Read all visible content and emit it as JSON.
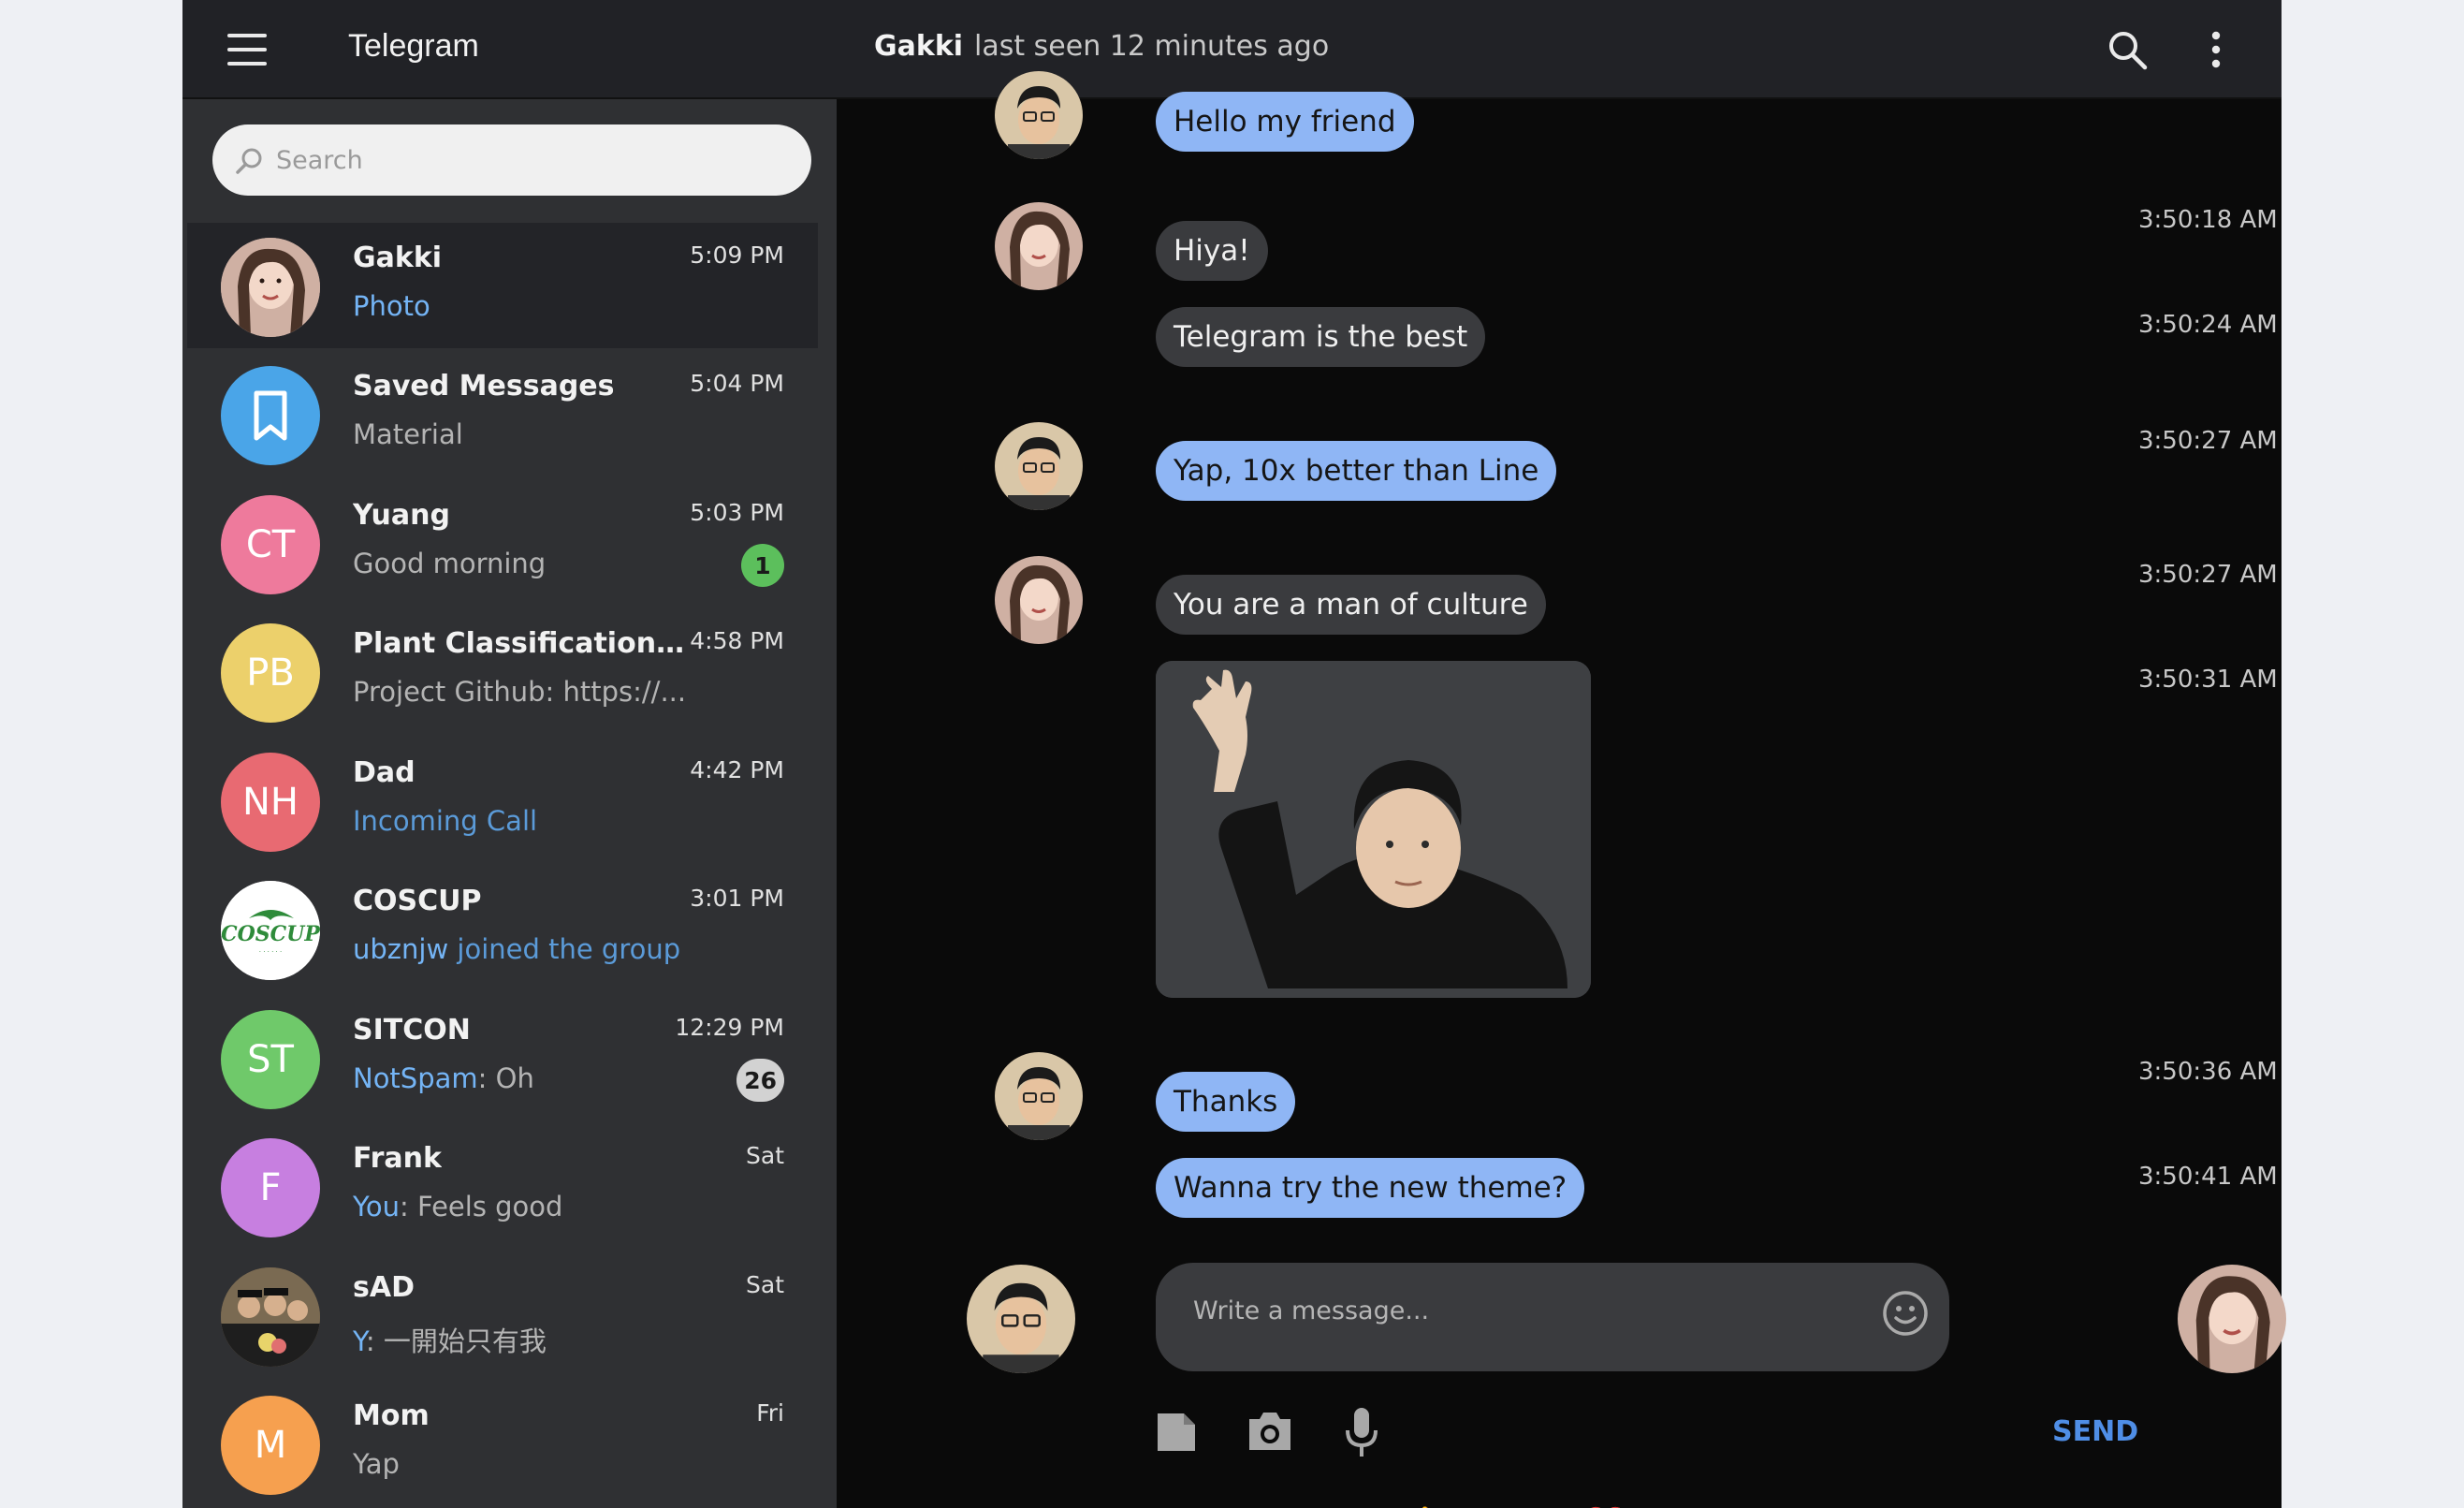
{
  "app": {
    "title": "Telegram"
  },
  "header": {
    "chat_name": "Gakki",
    "status": "last seen 12 minutes ago"
  },
  "search": {
    "placeholder": "Search"
  },
  "chats": [
    {
      "name": "Gakki",
      "time": "5:09 PM",
      "preview_sender": "",
      "preview": "Photo",
      "preview_style": "lblue",
      "avatar_text": "",
      "avatar_color": "#d9b9ad",
      "badge": ""
    },
    {
      "name": "Saved Messages",
      "time": "5:04 PM",
      "preview_sender": "",
      "preview": "Material",
      "preview_style": "grey",
      "avatar_text": "",
      "avatar_color": "#4aa5e8",
      "badge": ""
    },
    {
      "name": "Yuang",
      "time": "5:03 PM",
      "preview_sender": "",
      "preview": "Good morning",
      "preview_style": "grey",
      "avatar_text": "CT",
      "avatar_color": "#ee7a9c",
      "badge": "1"
    },
    {
      "name": "Plant Classification ...",
      "time": "4:58 PM",
      "preview_sender": "",
      "preview": "Project Github: https://...",
      "preview_style": "grey",
      "avatar_text": "PB",
      "avatar_color": "#ecd06b",
      "badge": ""
    },
    {
      "name": "Dad",
      "time": "4:42 PM",
      "preview_sender": "",
      "preview": "Incoming Call",
      "preview_style": "blue",
      "avatar_text": "NH",
      "avatar_color": "#e86a72",
      "badge": ""
    },
    {
      "name": "COSCUP",
      "time": "3:01 PM",
      "preview_sender": "ubznjw",
      "preview": " joined the group",
      "preview_style": "blue",
      "avatar_text": "COSCUP",
      "avatar_color": "#ffffff",
      "badge": ""
    },
    {
      "name": "SITCON",
      "time": "12:29 PM",
      "preview_sender": "NotSpam",
      "preview": ": Oh",
      "preview_style": "grey",
      "avatar_text": "ST",
      "avatar_color": "#6fc96a",
      "badge": "26"
    },
    {
      "name": "Frank",
      "time": "Sat",
      "preview_sender": "You",
      "preview": ": Feels good",
      "preview_style": "grey",
      "avatar_text": "F",
      "avatar_color": "#c77fe0",
      "badge": ""
    },
    {
      "name": "sAD",
      "time": "Sat",
      "preview_sender": "Y",
      "preview": ": 一開始只有我",
      "preview_style": "grey",
      "avatar_text": "",
      "avatar_color": "#6b5a42",
      "badge": ""
    },
    {
      "name": "Mom",
      "time": "Fri",
      "preview_sender": "",
      "preview": "Yap",
      "preview_style": "grey",
      "avatar_text": "M",
      "avatar_color": "#f6a04f",
      "badge": ""
    }
  ],
  "messages": [
    {
      "text": "Hello my friend",
      "from": "me",
      "time": ""
    },
    {
      "text": "Hiya!",
      "from": "them",
      "time": "3:50:18 AM"
    },
    {
      "text": "Telegram is the best",
      "from": "them",
      "time": "3:50:24 AM"
    },
    {
      "text": "Yap, 10x better than Line",
      "from": "me",
      "time": "3:50:27 AM"
    },
    {
      "text": "You are a man of culture",
      "from": "them",
      "time": "3:50:27 AM"
    },
    {
      "text": "",
      "from": "them",
      "time": "3:50:31 AM",
      "sticker": true
    },
    {
      "text": "Thanks",
      "from": "me",
      "time": "3:50:36 AM"
    },
    {
      "text": "Wanna try the new theme?",
      "from": "me",
      "time": "3:50:41 AM"
    }
  ],
  "composer": {
    "placeholder": "Write a message...",
    "send_label": "SEND"
  },
  "quick_emojis": [
    "👍",
    "😂",
    "😘",
    "❤️",
    "😍",
    "😊",
    "😁"
  ],
  "colors": {
    "accent": "#4f8ee6",
    "my_bubble": "#8fb6f5",
    "their_bubble": "#3a3b3e",
    "sidebar": "#2f3033",
    "background": "#0a0a0a"
  }
}
